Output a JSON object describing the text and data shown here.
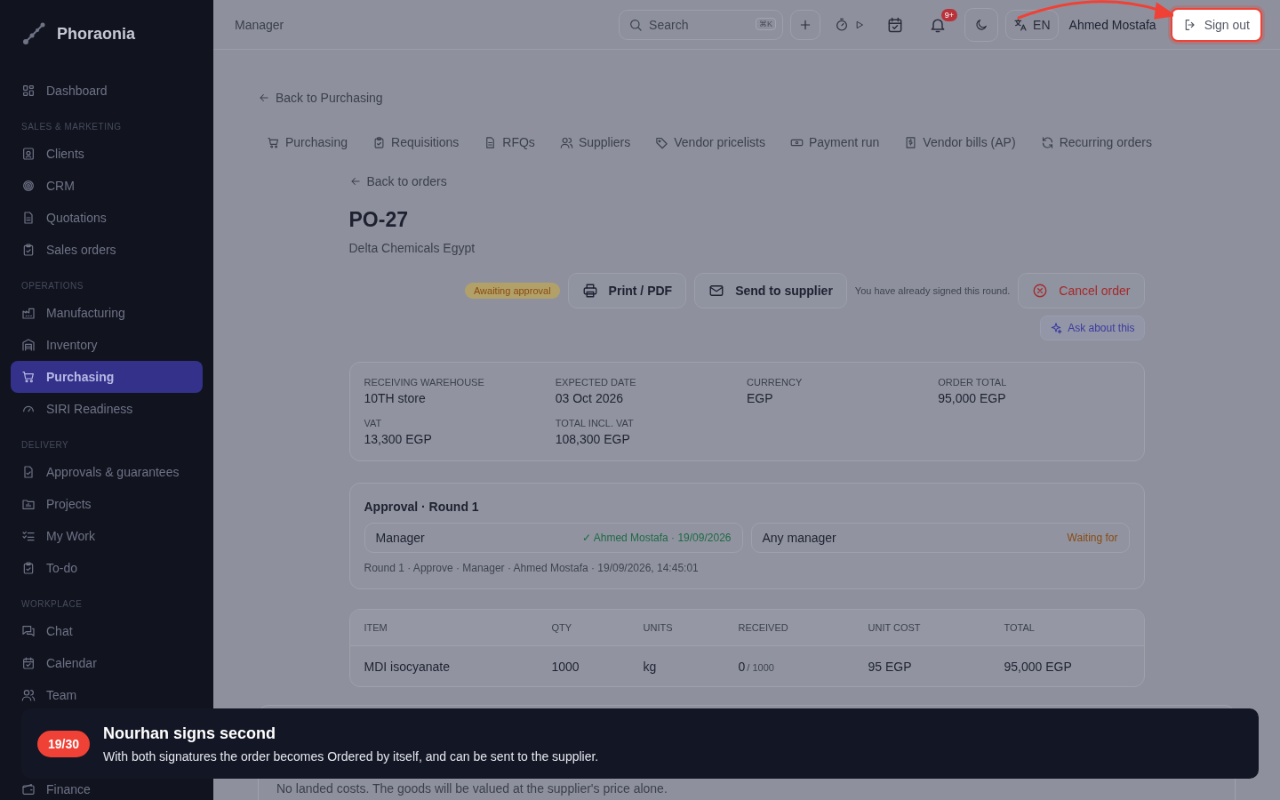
{
  "sidebar": {
    "logo": "Phoraonia",
    "sections": [
      {
        "items": [
          {
            "label": "Dashboard",
            "selected": false
          }
        ]
      },
      {
        "header": "SALES & MARKETING",
        "items": [
          {
            "label": "Clients",
            "selected": false
          },
          {
            "label": "CRM",
            "selected": false
          },
          {
            "label": "Quotations",
            "selected": false
          },
          {
            "label": "Sales orders",
            "selected": false
          }
        ]
      },
      {
        "header": "OPERATIONS",
        "items": [
          {
            "label": "Manufacturing",
            "selected": false
          },
          {
            "label": "Inventory",
            "selected": false
          },
          {
            "label": "Purchasing",
            "selected": true
          },
          {
            "label": "SIRI Readiness",
            "selected": false
          }
        ]
      },
      {
        "header": "DELIVERY",
        "items": [
          {
            "label": "Approvals & guarantees",
            "selected": false
          },
          {
            "label": "Projects",
            "selected": false
          },
          {
            "label": "My Work",
            "selected": false
          },
          {
            "label": "To-do",
            "selected": false
          }
        ]
      },
      {
        "header": "WORKPLACE",
        "items": [
          {
            "label": "Chat",
            "selected": false
          },
          {
            "label": "Calendar",
            "selected": false
          },
          {
            "label": "Team",
            "selected": false
          }
        ]
      }
    ],
    "bottom_item": {
      "label": "Finance",
      "selected": false
    }
  },
  "topbar": {
    "title": "Manager",
    "search": {
      "placeholder": "Search",
      "shortcut": "⌘K"
    },
    "notification_badge": "9+",
    "language": "EN",
    "user": "Ahmed Mostafa",
    "sign_out": "Sign out"
  },
  "back_link": "Back to Purchasing",
  "tabs": [
    {
      "label": "Purchasing"
    },
    {
      "label": "Requisitions"
    },
    {
      "label": "RFQs"
    },
    {
      "label": "Suppliers"
    },
    {
      "label": "Vendor pricelists"
    },
    {
      "label": "Payment run"
    },
    {
      "label": "Vendor bills (AP)"
    },
    {
      "label": "Recurring orders"
    }
  ],
  "order": {
    "back_link": "Back to orders",
    "title": "PO-27",
    "supplier": "Delta Chemicals Egypt",
    "status": "Awaiting approval",
    "print": "Print / PDF",
    "send": "Send to supplier",
    "note": "You have already signed this round.",
    "cancel": "Cancel order",
    "ask": "Ask about this",
    "summary": [
      {
        "label": "RECEIVING WAREHOUSE",
        "value": "10TH store"
      },
      {
        "label": "EXPECTED DATE",
        "value": "03 Oct 2026"
      },
      {
        "label": "CURRENCY",
        "value": "EGP"
      },
      {
        "label": "ORDER TOTAL",
        "value": "95,000 EGP"
      },
      {
        "label": "VAT",
        "value": "13,300 EGP"
      },
      {
        "label": "TOTAL INCL. VAT",
        "value": "108,300 EGP"
      }
    ],
    "approval": {
      "title": "Approval · Round 1",
      "signers": [
        {
          "role": "Manager",
          "status": "✓ Ahmed Mostafa · 19/09/2026",
          "signed": true
        },
        {
          "role": "Any manager",
          "status": "Waiting for",
          "signed": false
        }
      ],
      "log": "Round 1 · Approve · Manager · Ahmed Mostafa · 19/09/2026, 14:45:01"
    },
    "table": {
      "columns": [
        "ITEM",
        "QTY",
        "UNITS",
        "RECEIVED",
        "UNIT COST",
        "TOTAL"
      ],
      "rows": [
        {
          "item": "MDI isocyanate",
          "qty": "1000",
          "units": "kg",
          "received": "0",
          "received_of": "/ 1000",
          "unit_cost": "95 EGP",
          "total": "95,000 EGP"
        }
      ]
    },
    "landed_cost_note": "No landed costs. The goods will be valued at the supplier's price alone."
  },
  "tour": {
    "step": "19/30",
    "title": "Nourhan signs second",
    "body": "With both signatures the order becomes Ordered by itself, and can be sent to the supplier."
  }
}
